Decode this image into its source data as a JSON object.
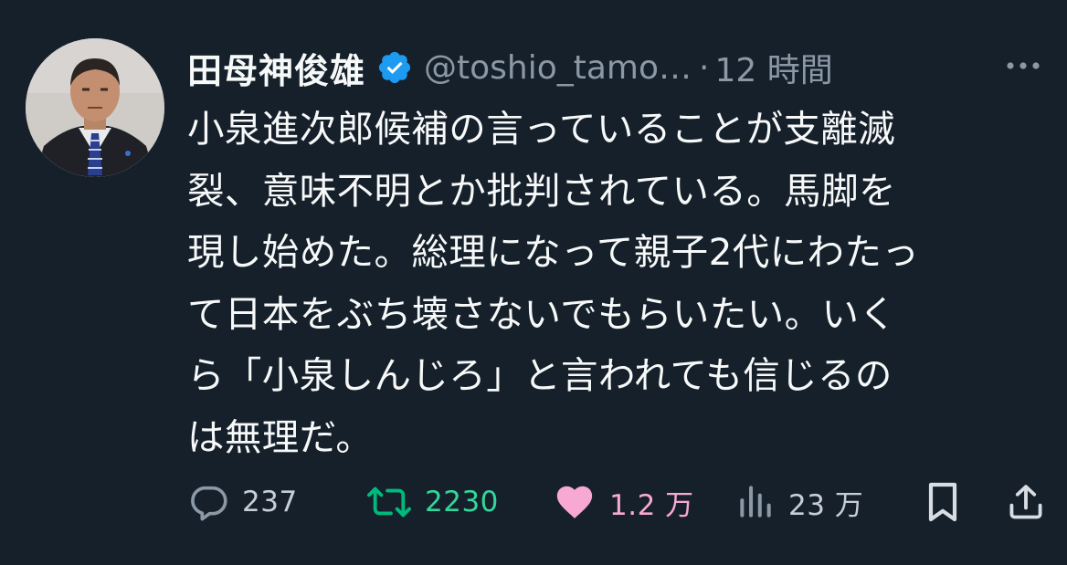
{
  "author": {
    "name": "田母神俊雄",
    "handle": "@toshio_tamo…",
    "separator": "·",
    "time": "12 時間",
    "verified": true,
    "verified_color": "#1d9bf0"
  },
  "tweet": {
    "text": "小泉進次郎候補の言っていることが支離滅\n裂、意味不明とか批判されている。馬脚を\n現し始めた。総理になって親子2代にわたっ\nて日本をぶち壊さないでもらいたい。いく\nら「小泉しんじろ」と言われても信じるの\nは無理だ。"
  },
  "actions": {
    "reply": {
      "icon": "reply-icon",
      "count": "237"
    },
    "retweet": {
      "icon": "retweet-icon",
      "count": "2230",
      "color": "#00ba7c"
    },
    "like": {
      "icon": "heart-icon",
      "count": "1.2 万",
      "color": "#f91880"
    },
    "views": {
      "icon": "views-icon",
      "count": "23 万"
    },
    "bookmark": {
      "icon": "bookmark-icon"
    },
    "share": {
      "icon": "share-icon"
    }
  },
  "colors": {
    "background": "#15202b",
    "text": "#f7f9f9",
    "secondary": "#8b98a5"
  }
}
